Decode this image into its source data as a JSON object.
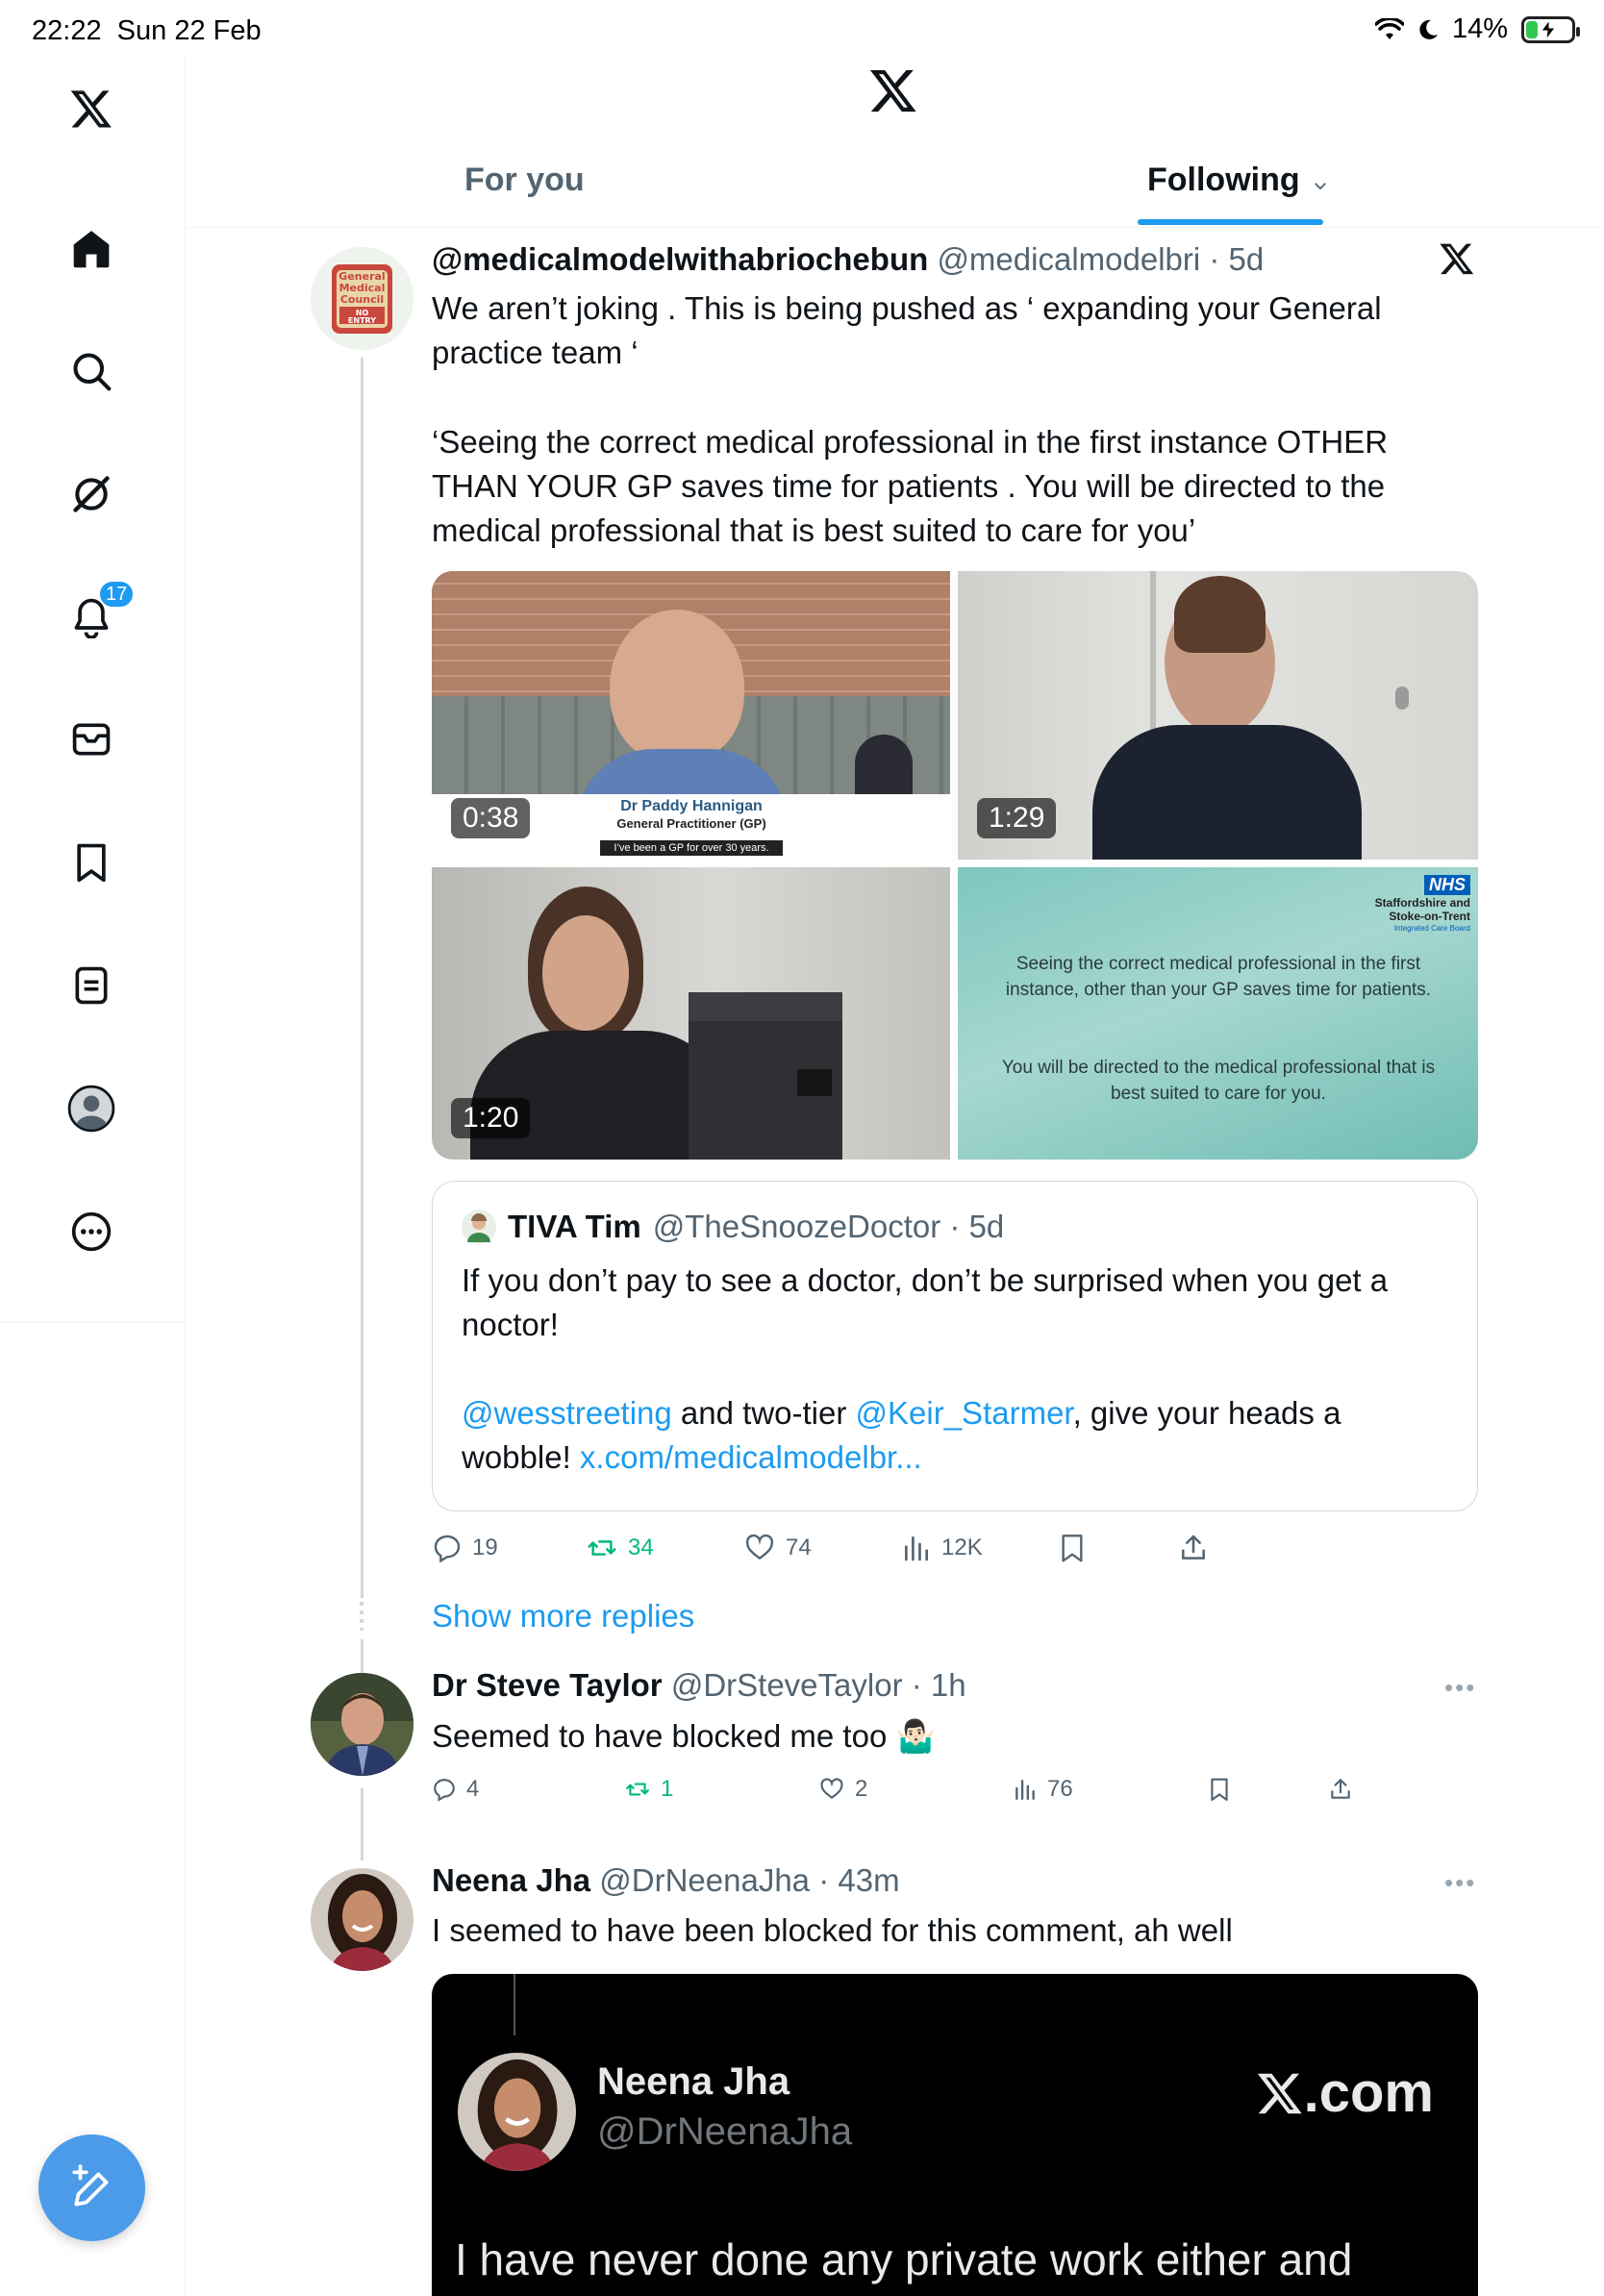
{
  "status_bar": {
    "time_date": "22:22  Sun 22 Feb",
    "battery": "14%"
  },
  "sidebar": {
    "notifications_badge": "17"
  },
  "header": {
    "tabs": [
      {
        "label": "For you"
      },
      {
        "label": "Following"
      }
    ]
  },
  "main_tweet": {
    "name": "@medicalmodelwithabriochebun",
    "handle": "@medicalmodelbri",
    "time": "5d",
    "text_1": "We aren’t joking . This is being pushed as ‘ expanding your General practice team ‘",
    "text_2": "‘Seeing the correct medical professional in the first instance OTHER THAN YOUR GP saves time for patients . You will be directed to the medical professional that is best suited to care for you’",
    "avatar_text": [
      "General",
      "Medical",
      "Council",
      "NO",
      "ENTRY"
    ],
    "media": [
      {
        "duration": "0:38",
        "caption_name": "Dr Paddy Hannigan",
        "caption_role": "General Practitioner (GP)",
        "caption_sub": "I’ve been a GP for over 30 years."
      },
      {
        "duration": "1:29"
      },
      {
        "duration": "1:20"
      },
      {
        "nhs": "NHS",
        "org_1": "Staffordshire and",
        "org_2": "Stoke-on-Trent",
        "org_3": "Integrated Care Board",
        "text_1": "Seeing the correct medical professional in the first instance, other than your GP saves time for patients.",
        "text_2": "You will be directed to the medical professional that is best suited to care for you."
      }
    ],
    "quote": {
      "name": "TIVA Tim",
      "handle": "@TheSnoozeDoctor",
      "time": "5d",
      "line_1": "If you don’t pay to see a doctor, don’t be surprised when you get a noctor!",
      "mention_1": "@wesstreeting",
      "mid": " and two-tier ",
      "mention_2": "@Keir_Starmer",
      "tail": ", give your heads a wobble! ",
      "link": "x.com/medicalmodelbr..."
    },
    "stats": {
      "replies": "19",
      "reposts": "34",
      "likes": "74",
      "views": "12K"
    }
  },
  "show_more": "Show more replies",
  "reply_1": {
    "name": "Dr Steve Taylor",
    "handle": "@DrSteveTaylor",
    "time": "1h",
    "text": "Seemed to have blocked me too 🤷🏻‍♂️",
    "stats": {
      "replies": "4",
      "reposts": "1",
      "likes": "2",
      "views": "76"
    }
  },
  "reply_2": {
    "name": "Neena Jha",
    "handle": "@DrNeenaJha",
    "time": "43m",
    "text": "I seemed to have been blocked for this comment, ah well",
    "embed": {
      "name": "Neena Jha",
      "handle": "@DrNeenaJha",
      "brand": ".com",
      "text": "I have never done any private work either and"
    }
  },
  "colors": {
    "accent": "#1d9bf0",
    "repost_green": "#00ba7c",
    "muted": "#536471"
  }
}
